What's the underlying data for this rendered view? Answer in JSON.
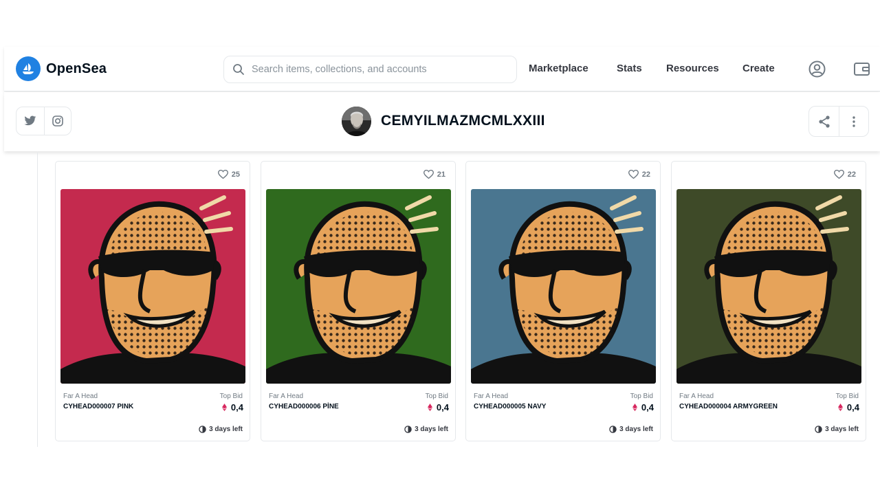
{
  "nav": {
    "brand": "OpenSea",
    "search_placeholder": "Search items, collections, and accounts",
    "links": [
      "Marketplace",
      "Stats",
      "Resources",
      "Create"
    ]
  },
  "profile": {
    "username": "CEMYILMAZMCMLXXIII"
  },
  "cards": [
    {
      "likes": "25",
      "collection": "Far A Head",
      "name": "CYHEAD000007 PINK",
      "bid_label": "Top Bid",
      "bid": "0,4",
      "time_left": "3 days left",
      "bg_color": "#c42a4e"
    },
    {
      "likes": "21",
      "collection": "Far A Head",
      "name": "CYHEAD000006 PİNE",
      "bid_label": "Top Bid",
      "bid": "0,4",
      "time_left": "3 days left",
      "bg_color": "#2f6a1e"
    },
    {
      "likes": "22",
      "collection": "Far A Head",
      "name": "CYHEAD000005 NAVY",
      "bid_label": "Top Bid",
      "bid": "0,4",
      "time_left": "3 days left",
      "bg_color": "#4a7690"
    },
    {
      "likes": "22",
      "collection": "Far A Head",
      "name": "CYHEAD000004 ARMYGREEN",
      "bid_label": "Top Bid",
      "bid": "0,4",
      "time_left": "3 days left",
      "bg_color": "#3e4a28"
    }
  ],
  "colors": {
    "brand_blue": "#2081e2",
    "eth_pink": "#d7285f",
    "text_dark": "#04111d",
    "text_muted": "#707a83",
    "border": "#e5e8eb"
  }
}
